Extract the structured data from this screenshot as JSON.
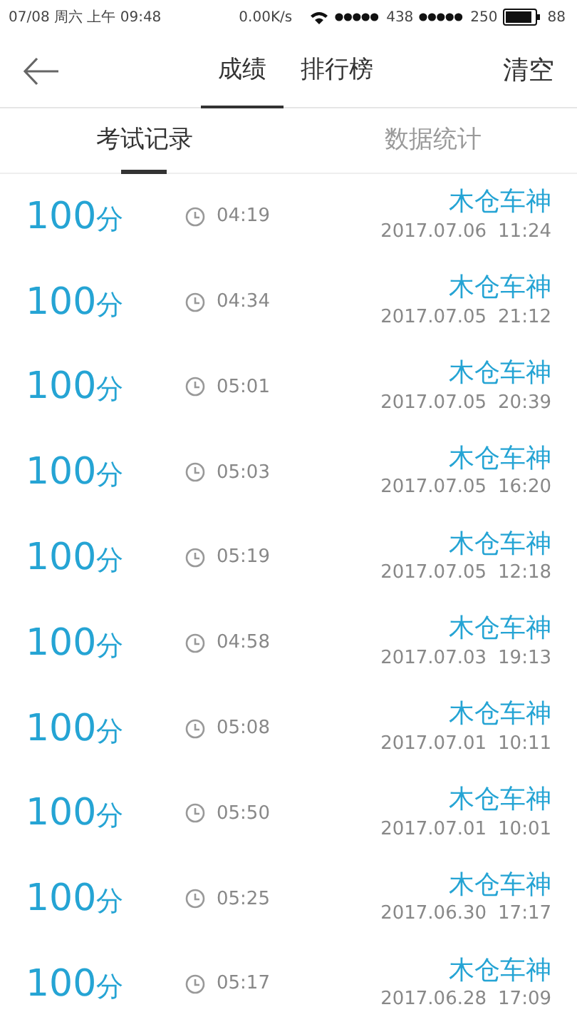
{
  "status_bar": {
    "datetime": "07/08 周六 上午 09:48",
    "speed": "0.00K/s",
    "signal_1": "438",
    "signal_2": "250",
    "battery": "88"
  },
  "header": {
    "tabs": [
      {
        "label": "成绩",
        "selected": true
      },
      {
        "label": "排行榜",
        "selected": false
      }
    ],
    "action": "清空"
  },
  "sub_tabs": [
    {
      "label": "考试记录",
      "selected": true
    },
    {
      "label": "数据统计",
      "selected": false
    }
  ],
  "records": [
    {
      "score": "100",
      "unit": "分",
      "duration": "04:19",
      "name": "木仓车神",
      "date": "2017.07.06",
      "time": "11:24"
    },
    {
      "score": "100",
      "unit": "分",
      "duration": "04:34",
      "name": "木仓车神",
      "date": "2017.07.05",
      "time": "21:12"
    },
    {
      "score": "100",
      "unit": "分",
      "duration": "05:01",
      "name": "木仓车神",
      "date": "2017.07.05",
      "time": "20:39"
    },
    {
      "score": "100",
      "unit": "分",
      "duration": "05:03",
      "name": "木仓车神",
      "date": "2017.07.05",
      "time": "16:20"
    },
    {
      "score": "100",
      "unit": "分",
      "duration": "05:19",
      "name": "木仓车神",
      "date": "2017.07.05",
      "time": "12:18"
    },
    {
      "score": "100",
      "unit": "分",
      "duration": "04:58",
      "name": "木仓车神",
      "date": "2017.07.03",
      "time": "19:13"
    },
    {
      "score": "100",
      "unit": "分",
      "duration": "05:08",
      "name": "木仓车神",
      "date": "2017.07.01",
      "time": "10:11"
    },
    {
      "score": "100",
      "unit": "分",
      "duration": "05:50",
      "name": "木仓车神",
      "date": "2017.07.01",
      "time": "10:01"
    },
    {
      "score": "100",
      "unit": "分",
      "duration": "05:25",
      "name": "木仓车神",
      "date": "2017.06.30",
      "time": "17:17"
    },
    {
      "score": "100",
      "unit": "分",
      "duration": "05:17",
      "name": "木仓车神",
      "date": "2017.06.28",
      "time": "17:09"
    }
  ]
}
